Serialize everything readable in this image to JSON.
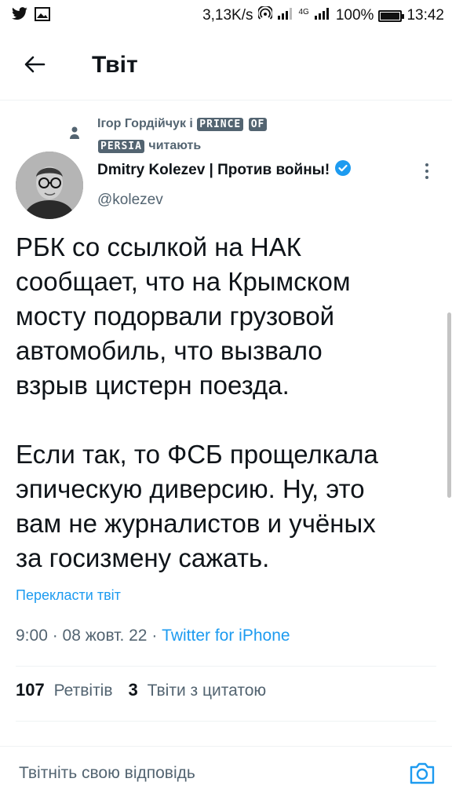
{
  "status_bar": {
    "network_speed": "3,13K/s",
    "network_type": "4G",
    "battery": "100%",
    "battery_level": 1.0,
    "time": "13:42",
    "icons": [
      "twitter-icon",
      "image-icon",
      "hotspot-icon",
      "signal-icon",
      "battery-icon"
    ]
  },
  "header": {
    "back_icon": "arrow-left-icon",
    "title": "Твіт"
  },
  "social_context": {
    "icon": "person-icon",
    "prefix": "Ігор Гордійчук і",
    "badge_1": "PRINCE",
    "badge_2": "OF",
    "badge_3": "PERSIA",
    "suffix": "читають"
  },
  "author": {
    "name": "Dmitry Kolezev | Против войны!",
    "handle": "@kolezev",
    "verified_icon": "verified-badge-icon",
    "more_icon": "more-vertical-icon"
  },
  "tweet": {
    "text": "РБК со ссылкой на НАК\nсообщает, что на Крымском\nмосту подорвали грузовой\nавтомобиль, что вызвало\nвзрыв цистерн поезда.\n\nЕсли так, то ФСБ прощелкала\nэпическую диверсию. Ну, это\nвам не журналистов и учёных\nза госизмену сажать.",
    "translate_label": "Перекласти твіт",
    "time": "9:00",
    "date": "08 жовт. 22",
    "source": "Twitter for iPhone"
  },
  "stats": {
    "retweets_count": "107",
    "retweets_label": "Ретвітів",
    "quotes_count": "3",
    "quotes_label": "Твіти з цитатою"
  },
  "reply_bar": {
    "placeholder": "Твітніть свою відповідь",
    "camera_icon": "camera-icon"
  },
  "colors": {
    "accent": "#1d9bf0",
    "text_primary": "#0f1419",
    "text_secondary": "#536471",
    "divider": "#eff3f4"
  }
}
